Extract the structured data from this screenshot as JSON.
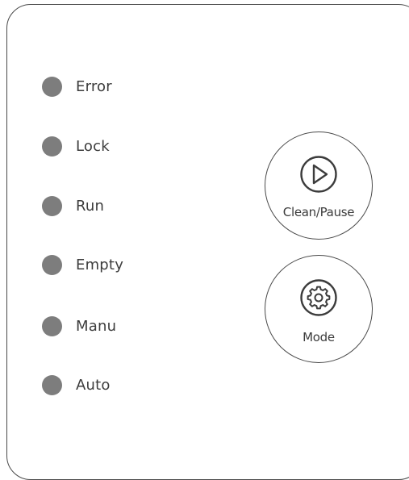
{
  "indicators": [
    {
      "label": "Error"
    },
    {
      "label": "Lock"
    },
    {
      "label": "Run"
    },
    {
      "label": "Empty"
    },
    {
      "label": "Manu"
    },
    {
      "label": "Auto"
    }
  ],
  "buttons": {
    "clean_pause": {
      "label": "Clean/Pause",
      "icon": "play-icon"
    },
    "mode": {
      "label": "Mode",
      "icon": "gear-icon"
    }
  },
  "colors": {
    "led": "#7d7d7d",
    "outline": "#4a4a4a",
    "text": "#3c3c3c"
  }
}
